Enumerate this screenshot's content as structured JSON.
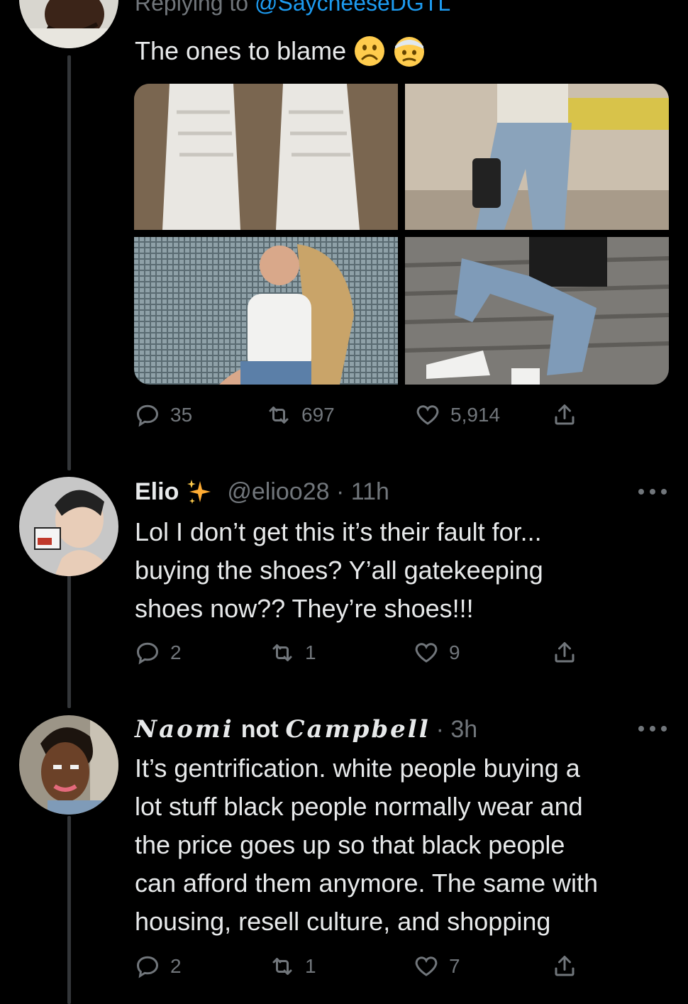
{
  "tweet_main": {
    "replying_prefix": "Replying to ",
    "replying_handle": "@SaycheeseDGTL",
    "text": "The ones to blame",
    "emojis": [
      "frowning-face-icon",
      "face-with-head-bandage-icon"
    ],
    "media_count": 4,
    "stats": {
      "replies": "35",
      "retweets": "697",
      "likes": "5,914"
    }
  },
  "reply_1": {
    "name": "Elio",
    "name_emoji": "sparkles-icon",
    "handle_time": "@elioo28 · 11h",
    "text_lines": [
      "Lol I don’t get this it’s their fault for...",
      "buying the shoes? Y’all  gatekeeping",
      "shoes now?? They’re shoes!!!"
    ],
    "stats": {
      "replies": "2",
      "retweets": "1",
      "likes": "9"
    }
  },
  "reply_2": {
    "name_script_1": "Naomi",
    "name_plain": "not",
    "name_script_2": "Campbell",
    "time": "· 3h",
    "text_lines": [
      "It’s gentrification. white people buying a",
      "lot stuff black people normally wear and",
      "the price goes up so that black people",
      "can afford them anymore. The same with",
      "housing, resell culture, and shopping"
    ],
    "stats": {
      "replies": "2",
      "retweets": "1",
      "likes": "7"
    }
  },
  "colors": {
    "background": "#000000",
    "text": "#e7e9ea",
    "muted": "#71767b",
    "link": "#1d9bf0",
    "thread_line": "#333639"
  }
}
